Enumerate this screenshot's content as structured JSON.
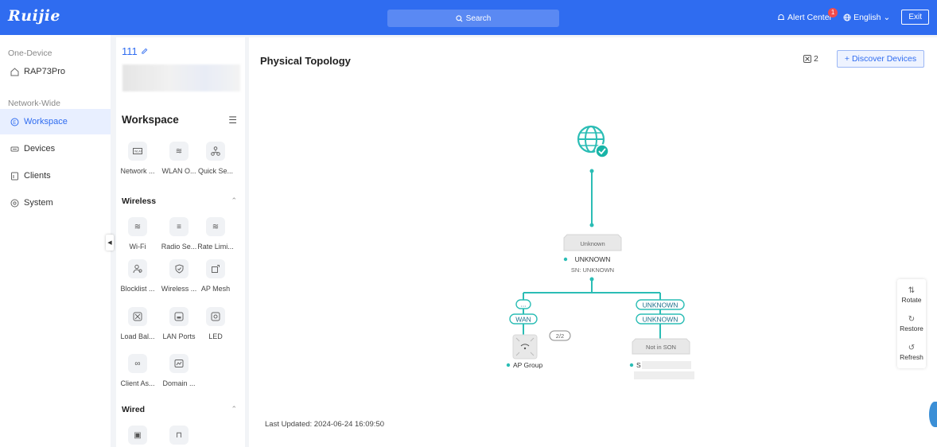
{
  "header": {
    "logo": "Ruijie",
    "search_label": "Search",
    "alert_label": "Alert Center",
    "alert_count": "1",
    "language": "English",
    "exit_label": "Exit"
  },
  "nav": {
    "section_one_device": "One-Device",
    "device_name": "RAP73Pro",
    "section_network_wide": "Network-Wide",
    "items": [
      {
        "label": "Workspace",
        "icon": "workspace-icon"
      },
      {
        "label": "Devices",
        "icon": "devices-icon"
      },
      {
        "label": "Clients",
        "icon": "clients-icon"
      },
      {
        "label": "System",
        "icon": "system-icon"
      }
    ]
  },
  "panel": {
    "network_name": "111",
    "workspace_title": "Workspace",
    "workspace_tiles": [
      "Network ...",
      "WLAN O...",
      "Quick Se..."
    ],
    "wireless_title": "Wireless",
    "wireless_tiles": [
      "Wi-Fi",
      "Radio Se...",
      "Rate Limi...",
      "Blocklist ...",
      "Wireless ...",
      "AP Mesh",
      "Load Bal...",
      "LAN Ports",
      "LED",
      "Client As...",
      "Domain ..."
    ],
    "wired_title": "Wired"
  },
  "main": {
    "title": "Physical Topology",
    "device_count": "2",
    "discover_label": "+ Discover Devices",
    "last_updated": "Last Updated: 2024-06-24 16:09:50",
    "tools": [
      "Rotate",
      "Restore",
      "Refresh"
    ]
  },
  "topology": {
    "root_box_label": "Unknown",
    "root_name": "UNKNOWN",
    "root_sn": "SN: UNKNOWN",
    "left_port_top": "...",
    "left_port_bottom": "WAN",
    "right_port_top": "UNKNOWN",
    "right_port_bottom": "UNKNOWN",
    "group_count": "2/2",
    "ap_group_label": "AP Group",
    "right_box_label": "Not in SON",
    "right_name": "S",
    "accent_color": "#2bbdb5"
  }
}
